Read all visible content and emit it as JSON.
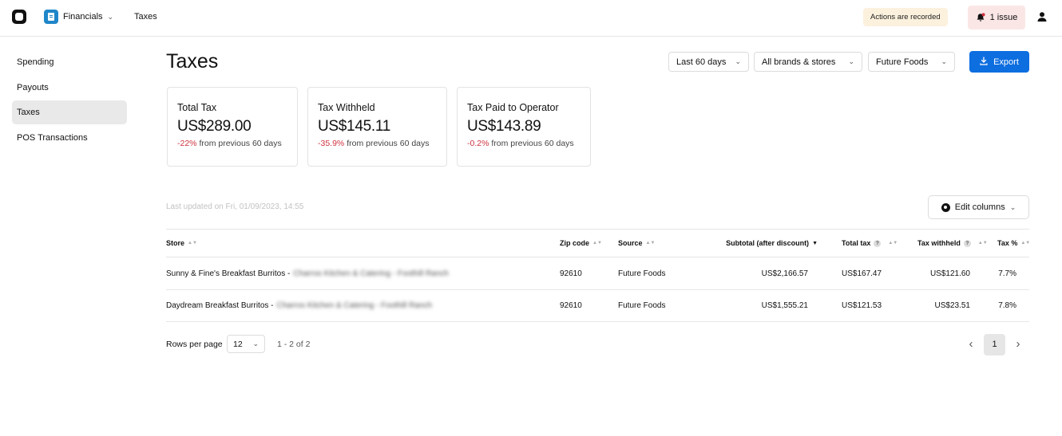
{
  "topbar": {
    "app_name": "Financials",
    "breadcrumb": "Taxes",
    "recorded_badge": "Actions are recorded",
    "issue_label": "1 issue"
  },
  "sidebar": {
    "items": [
      {
        "label": "Spending"
      },
      {
        "label": "Payouts"
      },
      {
        "label": "Taxes",
        "active": true
      },
      {
        "label": "POS Transactions"
      }
    ]
  },
  "header": {
    "title": "Taxes",
    "filters": {
      "date_range": "Last 60 days",
      "brands": "All brands & stores",
      "operator": "Future Foods"
    },
    "export_label": "Export"
  },
  "cards": [
    {
      "label": "Total Tax",
      "value": "US$289.00",
      "change": "-22%",
      "change_suffix": "from previous 60 days"
    },
    {
      "label": "Tax Withheld",
      "value": "US$145.11",
      "change": "-35.9%",
      "change_suffix": "from previous 60 days"
    },
    {
      "label": "Tax Paid to Operator",
      "value": "US$143.89",
      "change": "-0.2%",
      "change_suffix": "from previous 60 days"
    }
  ],
  "table_meta": {
    "last_updated": "Last updated on Fri, 01/09/2023, 14:55",
    "edit_columns_label": "Edit columns"
  },
  "table": {
    "columns": [
      "Store",
      "Zip code",
      "Source",
      "Subtotal (after discount)",
      "Total tax",
      "Tax withheld",
      "Tax %"
    ],
    "rows": [
      {
        "store": "Sunny & Fine's Breakfast Burritos -",
        "store_blurred": "Charros Kitchen & Catering - Foothill Ranch",
        "zip": "92610",
        "source": "Future Foods",
        "subtotal": "US$2,166.57",
        "total_tax": "US$167.47",
        "tax_withheld": "US$121.60",
        "tax_pct": "7.7%"
      },
      {
        "store": "Daydream Breakfast Burritos -",
        "store_blurred": "Charros Kitchen & Catering - Foothill Ranch",
        "zip": "92610",
        "source": "Future Foods",
        "subtotal": "US$1,555.21",
        "total_tax": "US$121.53",
        "tax_withheld": "US$23.51",
        "tax_pct": "7.8%"
      }
    ]
  },
  "pagination": {
    "rows_per_page_label": "Rows per page",
    "rows_per_page": "12",
    "range": "1 - 2 of 2",
    "current_page": "1"
  },
  "colors": {
    "accent": "#0d6ee0",
    "negative": "#d0323f",
    "app_icon": "#1f86c9",
    "recorded_badge_bg": "#fbf1dd",
    "issue_bg": "#fbe6e6"
  }
}
